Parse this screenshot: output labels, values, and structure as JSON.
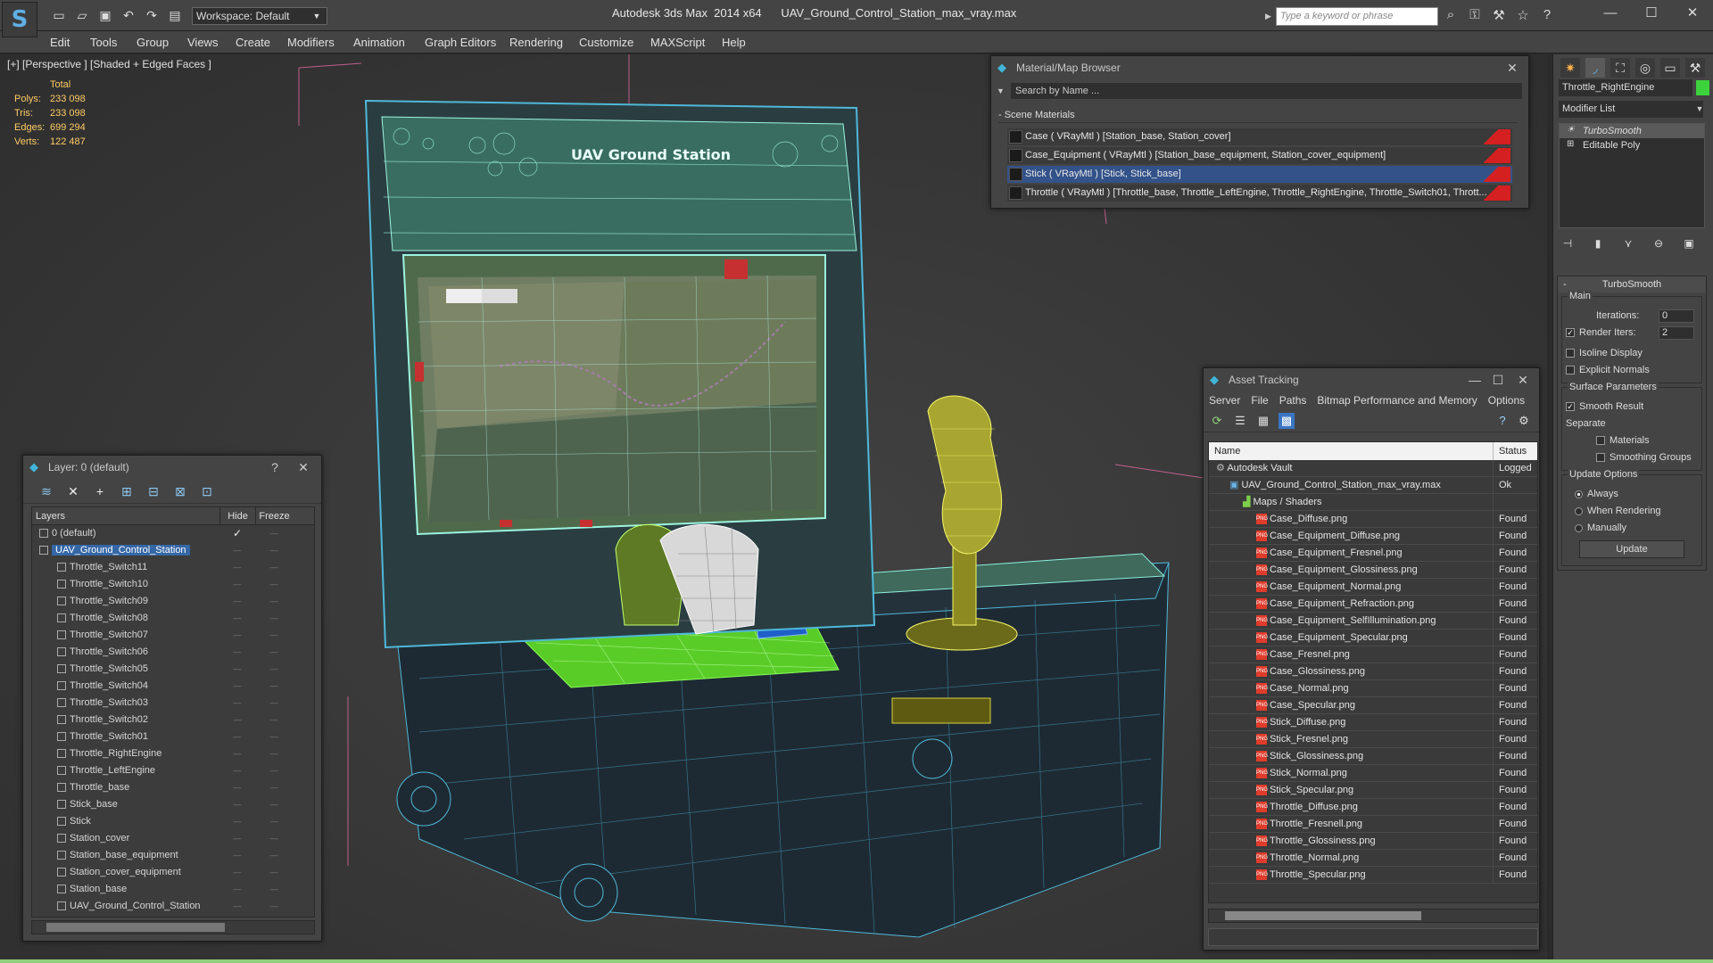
{
  "titlebar": {
    "workspace": "Workspace: Default",
    "app_title": "Autodesk 3ds Max  2014 x64      UAV_Ground_Control_Station_max_vray.max",
    "search_placeholder": "Type a keyword or phrase"
  },
  "menu": [
    "Edit",
    "Tools",
    "Group",
    "Views",
    "Create",
    "Modifiers",
    "Animation",
    "Graph Editors",
    "Rendering",
    "Customize",
    "MAXScript",
    "Help"
  ],
  "viewport": {
    "label": "[+] [Perspective ] [Shaded + Edged Faces ]",
    "stats": {
      "header": "Total",
      "rows": [
        {
          "k": "Polys:",
          "v": "233 098"
        },
        {
          "k": "Tris:",
          "v": "233 098"
        },
        {
          "k": "Edges:",
          "v": "699 294"
        },
        {
          "k": "Verts:",
          "v": "122 487"
        }
      ]
    },
    "screen_title": "UAV Ground Station"
  },
  "layer_explorer": {
    "title": "Layer: 0 (default)",
    "help": "?",
    "close": "✕",
    "columns": {
      "layers": "Layers",
      "hide": "Hide",
      "freeze": "Freeze"
    },
    "rows": [
      {
        "name": "0 (default)",
        "indent": 1,
        "selected": false,
        "check": "✓"
      },
      {
        "name": "UAV_Ground_Control_Station",
        "indent": 1,
        "selected": true,
        "check": ""
      },
      {
        "name": "Throttle_Switch11",
        "indent": 2
      },
      {
        "name": "Throttle_Switch10",
        "indent": 2
      },
      {
        "name": "Throttle_Switch09",
        "indent": 2
      },
      {
        "name": "Throttle_Switch08",
        "indent": 2
      },
      {
        "name": "Throttle_Switch07",
        "indent": 2
      },
      {
        "name": "Throttle_Switch06",
        "indent": 2
      },
      {
        "name": "Throttle_Switch05",
        "indent": 2
      },
      {
        "name": "Throttle_Switch04",
        "indent": 2
      },
      {
        "name": "Throttle_Switch03",
        "indent": 2
      },
      {
        "name": "Throttle_Switch02",
        "indent": 2
      },
      {
        "name": "Throttle_Switch01",
        "indent": 2
      },
      {
        "name": "Throttle_RightEngine",
        "indent": 2
      },
      {
        "name": "Throttle_LeftEngine",
        "indent": 2
      },
      {
        "name": "Throttle_base",
        "indent": 2
      },
      {
        "name": "Stick_base",
        "indent": 2
      },
      {
        "name": "Stick",
        "indent": 2
      },
      {
        "name": "Station_cover",
        "indent": 2
      },
      {
        "name": "Station_base_equipment",
        "indent": 2
      },
      {
        "name": "Station_cover_equipment",
        "indent": 2
      },
      {
        "name": "Station_base",
        "indent": 2
      },
      {
        "name": "UAV_Ground_Control_Station",
        "indent": 2
      }
    ]
  },
  "material_browser": {
    "title": "Material/Map Browser",
    "search": "Search by Name ...",
    "group": "- Scene Materials",
    "rows": [
      {
        "text": "Case  ( VRayMtl )  [Station_base, Station_cover]",
        "selected": false
      },
      {
        "text": "Case_Equipment  ( VRayMtl )  [Station_base_equipment, Station_cover_equipment]",
        "selected": false
      },
      {
        "text": "Stick  ( VRayMtl )  [Stick, Stick_base]",
        "selected": true
      },
      {
        "text": "Throttle  ( VRayMtl )  [Throttle_base, Throttle_LeftEngine, Throttle_RightEngine, Throttle_Switch01, Thrott...",
        "selected": false
      }
    ]
  },
  "asset_tracking": {
    "title": "Asset Tracking",
    "menu": [
      "Server",
      "File",
      "Paths",
      "Bitmap Performance and Memory",
      "Options"
    ],
    "columns": {
      "name": "Name",
      "status": "Status"
    },
    "rows": [
      {
        "name": "Autodesk Vault",
        "status": "Logged",
        "indent": 1,
        "kind": "vault"
      },
      {
        "name": "UAV_Ground_Control_Station_max_vray.max",
        "status": "Ok",
        "indent": 2,
        "kind": "max"
      },
      {
        "name": "Maps / Shaders",
        "status": "",
        "indent": 3,
        "kind": "folder"
      },
      {
        "name": "Case_Diffuse.png",
        "status": "Found",
        "indent": 4,
        "kind": "png"
      },
      {
        "name": "Case_Equipment_Diffuse.png",
        "status": "Found",
        "indent": 4,
        "kind": "png"
      },
      {
        "name": "Case_Equipment_Fresnel.png",
        "status": "Found",
        "indent": 4,
        "kind": "png"
      },
      {
        "name": "Case_Equipment_Glossiness.png",
        "status": "Found",
        "indent": 4,
        "kind": "png"
      },
      {
        "name": "Case_Equipment_Normal.png",
        "status": "Found",
        "indent": 4,
        "kind": "png"
      },
      {
        "name": "Case_Equipment_Refraction.png",
        "status": "Found",
        "indent": 4,
        "kind": "png"
      },
      {
        "name": "Case_Equipment_SelfIllumination.png",
        "status": "Found",
        "indent": 4,
        "kind": "png"
      },
      {
        "name": "Case_Equipment_Specular.png",
        "status": "Found",
        "indent": 4,
        "kind": "png"
      },
      {
        "name": "Case_Fresnel.png",
        "status": "Found",
        "indent": 4,
        "kind": "png"
      },
      {
        "name": "Case_Glossiness.png",
        "status": "Found",
        "indent": 4,
        "kind": "png"
      },
      {
        "name": "Case_Normal.png",
        "status": "Found",
        "indent": 4,
        "kind": "png"
      },
      {
        "name": "Case_Specular.png",
        "status": "Found",
        "indent": 4,
        "kind": "png"
      },
      {
        "name": "Stick_Diffuse.png",
        "status": "Found",
        "indent": 4,
        "kind": "png"
      },
      {
        "name": "Stick_Fresnel.png",
        "status": "Found",
        "indent": 4,
        "kind": "png"
      },
      {
        "name": "Stick_Glossiness.png",
        "status": "Found",
        "indent": 4,
        "kind": "png"
      },
      {
        "name": "Stick_Normal.png",
        "status": "Found",
        "indent": 4,
        "kind": "png"
      },
      {
        "name": "Stick_Specular.png",
        "status": "Found",
        "indent": 4,
        "kind": "png"
      },
      {
        "name": "Throttle_Diffuse.png",
        "status": "Found",
        "indent": 4,
        "kind": "png"
      },
      {
        "name": "Throttle_Fresnell.png",
        "status": "Found",
        "indent": 4,
        "kind": "png"
      },
      {
        "name": "Throttle_Glossiness.png",
        "status": "Found",
        "indent": 4,
        "kind": "png"
      },
      {
        "name": "Throttle_Normal.png",
        "status": "Found",
        "indent": 4,
        "kind": "png"
      },
      {
        "name": "Throttle_Specular.png",
        "status": "Found",
        "indent": 4,
        "kind": "png"
      }
    ]
  },
  "command_panel": {
    "object_name": "Throttle_RightEngine",
    "object_color": "#3cd23c",
    "modifier_list": "Modifier List",
    "stack": [
      {
        "name": "TurboSmooth",
        "selected": true
      },
      {
        "name": "Editable Poly",
        "selected": false
      }
    ],
    "turbosmooth": {
      "title": "TurboSmooth",
      "main": "Main",
      "iterations_label": "Iterations:",
      "iterations": "0",
      "render_iters_label": "Render Iters:",
      "render_iters": "2",
      "isoline": "Isoline Display",
      "explicit": "Explicit Normals",
      "surface": "Surface Parameters",
      "smooth_result": "Smooth Result",
      "separate": "Separate",
      "materials": "Materials",
      "smoothing_groups": "Smoothing Groups",
      "update_options": "Update Options",
      "always": "Always",
      "when_rendering": "When Rendering",
      "manually": "Manually",
      "update_button": "Update"
    }
  },
  "colors": {
    "wire_cyan": "#5fe0f0",
    "wire_green": "#7cff6a",
    "wire_yellow": "#f5f56a",
    "selection_blue": "#3567a6"
  }
}
